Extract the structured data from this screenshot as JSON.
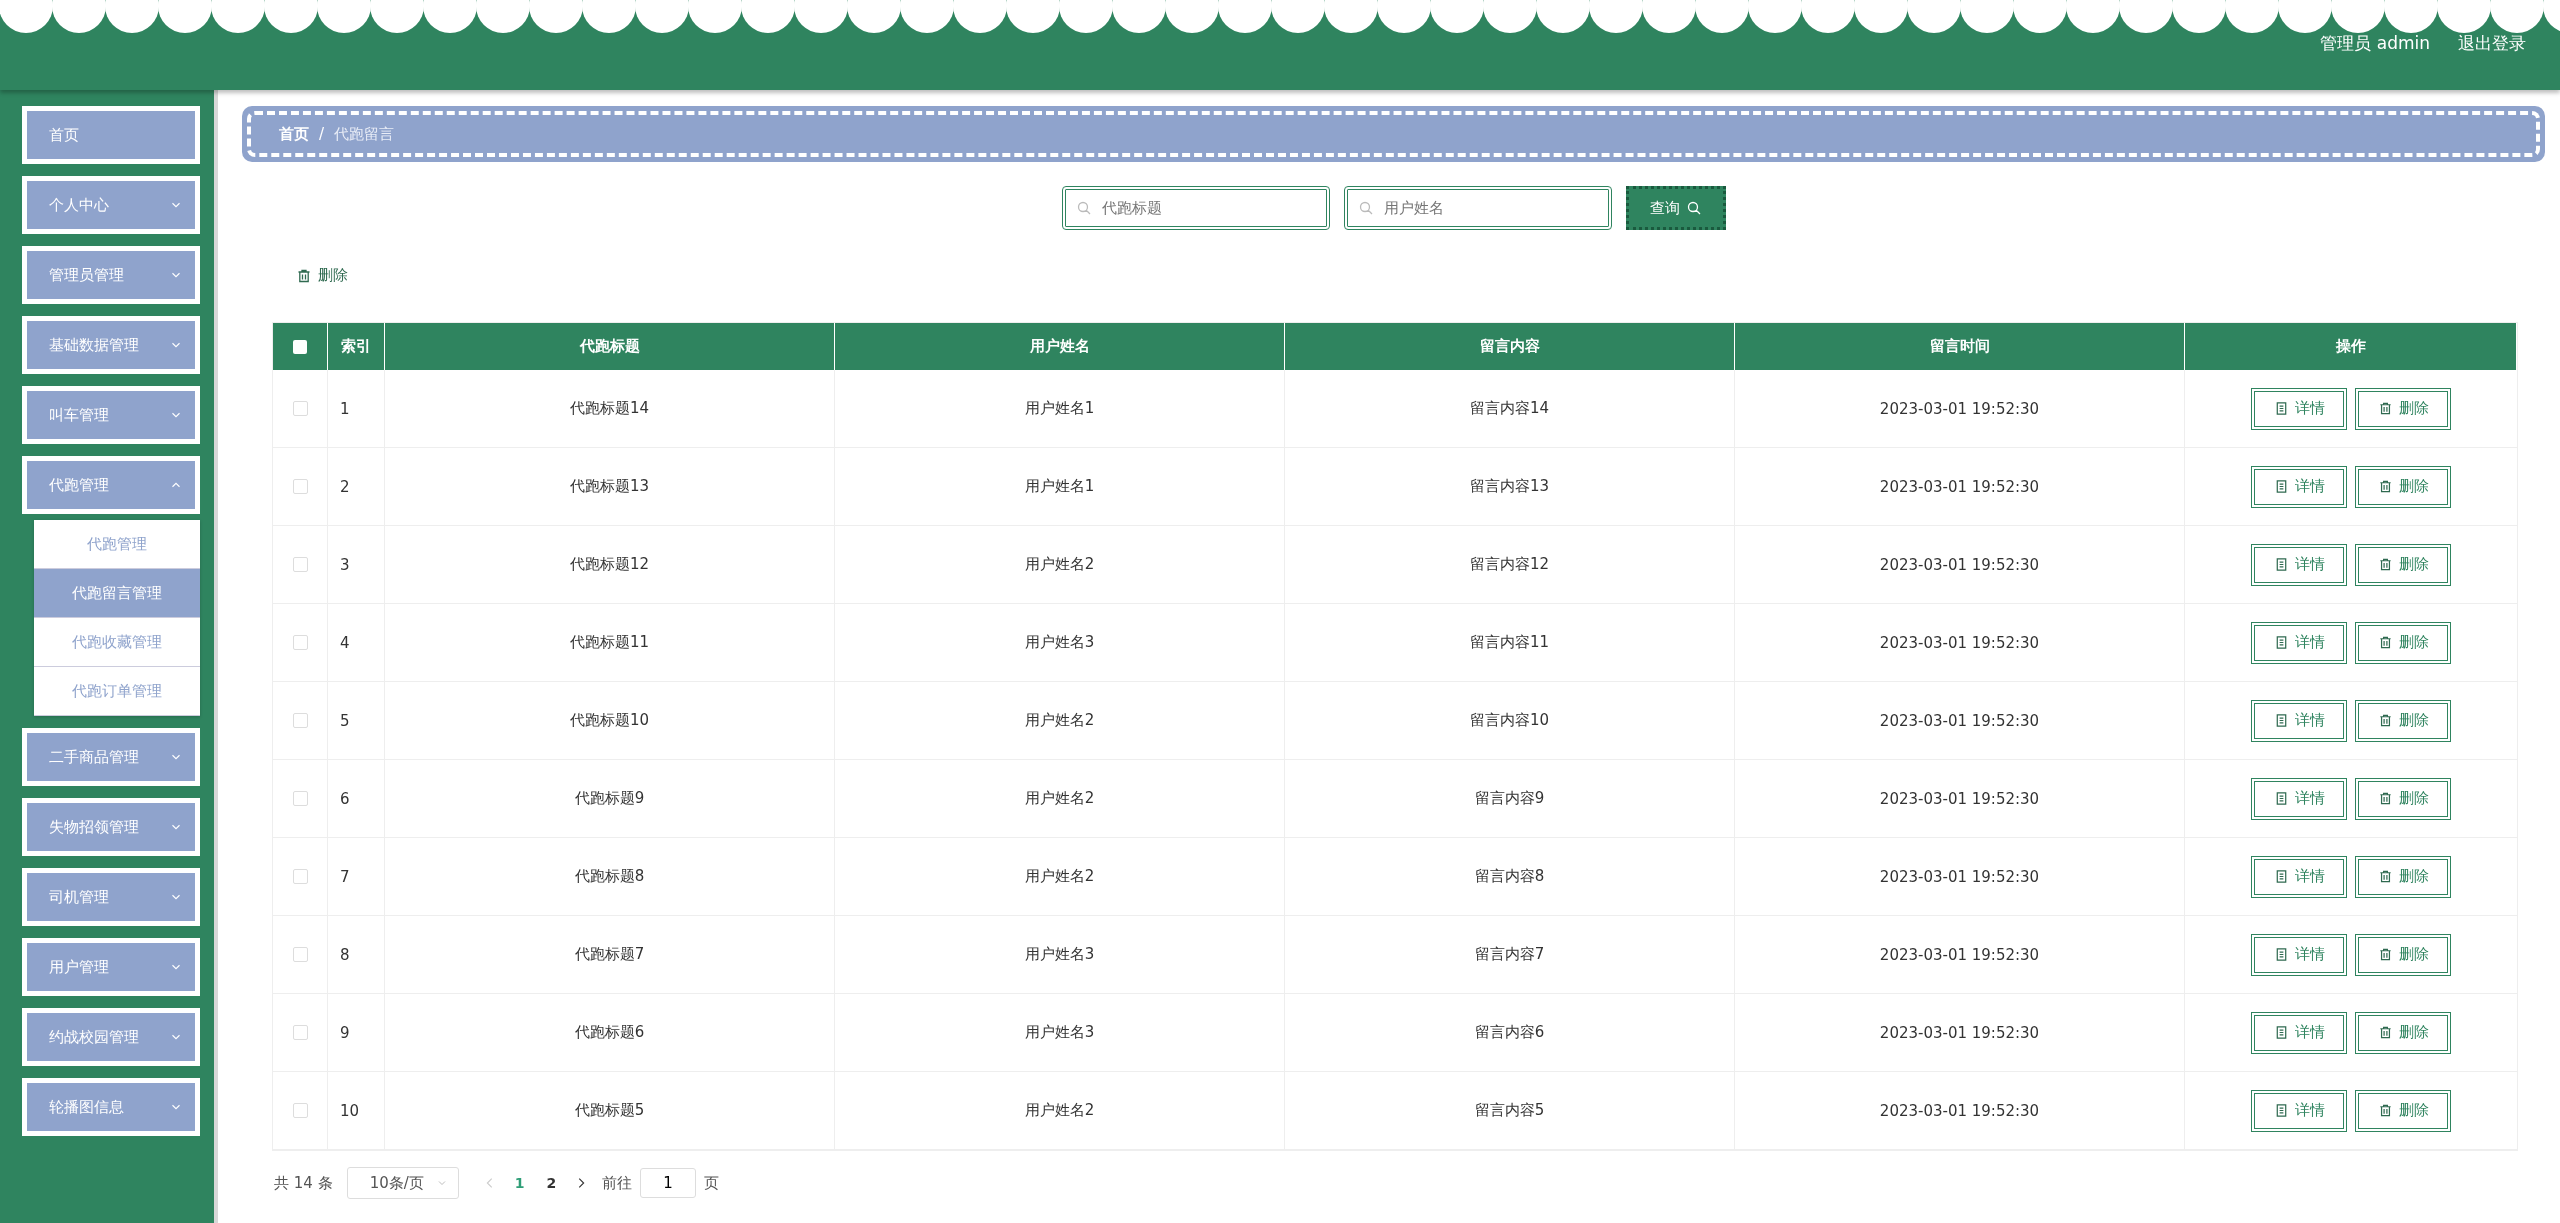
{
  "header": {
    "user": "管理员 admin",
    "logout": "退出登录"
  },
  "sidebar": {
    "items": [
      {
        "label": "首页",
        "selected": false
      },
      {
        "label": "个人中心",
        "expanded": false,
        "selected": false
      },
      {
        "label": "管理员管理",
        "expanded": false,
        "selected": false
      },
      {
        "label": "基础数据管理",
        "expanded": false,
        "selected": false
      },
      {
        "label": "叫车管理",
        "expanded": false,
        "selected": false
      },
      {
        "label": "代跑管理",
        "expanded": true,
        "selected": false,
        "children": [
          {
            "label": "代跑管理",
            "selected": false
          },
          {
            "label": "代跑留言管理",
            "selected": true
          },
          {
            "label": "代跑收藏管理",
            "selected": false
          },
          {
            "label": "代跑订单管理",
            "selected": false
          }
        ]
      },
      {
        "label": "二手商品管理",
        "expanded": false,
        "selected": false
      },
      {
        "label": "失物招领管理",
        "expanded": false,
        "selected": false
      },
      {
        "label": "司机管理",
        "expanded": false,
        "selected": false
      },
      {
        "label": "用户管理",
        "expanded": false,
        "selected": false
      },
      {
        "label": "约战校园管理",
        "expanded": false,
        "selected": false
      },
      {
        "label": "轮播图信息",
        "expanded": false,
        "selected": false
      }
    ]
  },
  "breadcrumb": {
    "separator": "/",
    "items": [
      "首页",
      "代跑留言"
    ]
  },
  "search": {
    "fields": [
      {
        "placeholder": "代跑标题"
      },
      {
        "placeholder": "用户姓名"
      }
    ],
    "button": "查询"
  },
  "toolbar": {
    "delete": "删除"
  },
  "table": {
    "header_checked": false,
    "columns": [
      "索引",
      "代跑标题",
      "用户姓名",
      "留言内容",
      "留言时间",
      "操作"
    ],
    "rows": [
      {
        "checked": false,
        "cells": [
          "1",
          "代跑标题14",
          "用户姓名1",
          "留言内容14",
          "2023-03-01 19:52:30"
        ],
        "actions": [
          "详情",
          "删除"
        ]
      },
      {
        "checked": false,
        "cells": [
          "2",
          "代跑标题13",
          "用户姓名1",
          "留言内容13",
          "2023-03-01 19:52:30"
        ],
        "actions": [
          "详情",
          "删除"
        ]
      },
      {
        "checked": false,
        "cells": [
          "3",
          "代跑标题12",
          "用户姓名2",
          "留言内容12",
          "2023-03-01 19:52:30"
        ],
        "actions": [
          "详情",
          "删除"
        ]
      },
      {
        "checked": false,
        "cells": [
          "4",
          "代跑标题11",
          "用户姓名3",
          "留言内容11",
          "2023-03-01 19:52:30"
        ],
        "actions": [
          "详情",
          "删除"
        ]
      },
      {
        "checked": false,
        "cells": [
          "5",
          "代跑标题10",
          "用户姓名2",
          "留言内容10",
          "2023-03-01 19:52:30"
        ],
        "actions": [
          "详情",
          "删除"
        ]
      },
      {
        "checked": false,
        "cells": [
          "6",
          "代跑标题9",
          "用户姓名2",
          "留言内容9",
          "2023-03-01 19:52:30"
        ],
        "actions": [
          "详情",
          "删除"
        ]
      },
      {
        "checked": false,
        "cells": [
          "7",
          "代跑标题8",
          "用户姓名2",
          "留言内容8",
          "2023-03-01 19:52:30"
        ],
        "actions": [
          "详情",
          "删除"
        ]
      },
      {
        "checked": false,
        "cells": [
          "8",
          "代跑标题7",
          "用户姓名3",
          "留言内容7",
          "2023-03-01 19:52:30"
        ],
        "actions": [
          "详情",
          "删除"
        ]
      },
      {
        "checked": false,
        "cells": [
          "9",
          "代跑标题6",
          "用户姓名3",
          "留言内容6",
          "2023-03-01 19:52:30"
        ],
        "actions": [
          "详情",
          "删除"
        ]
      },
      {
        "checked": false,
        "cells": [
          "10",
          "代跑标题5",
          "用户姓名2",
          "留言内容5",
          "2023-03-01 19:52:30"
        ],
        "actions": [
          "详情",
          "删除"
        ]
      }
    ]
  },
  "pagination": {
    "total": "共 14 条",
    "page_size": "10条/页",
    "pages": [
      {
        "label": "1",
        "selected": true
      },
      {
        "label": "2",
        "selected": false
      }
    ],
    "goto_label": "前往",
    "goto_value": "1",
    "goto_suffix": "页"
  }
}
